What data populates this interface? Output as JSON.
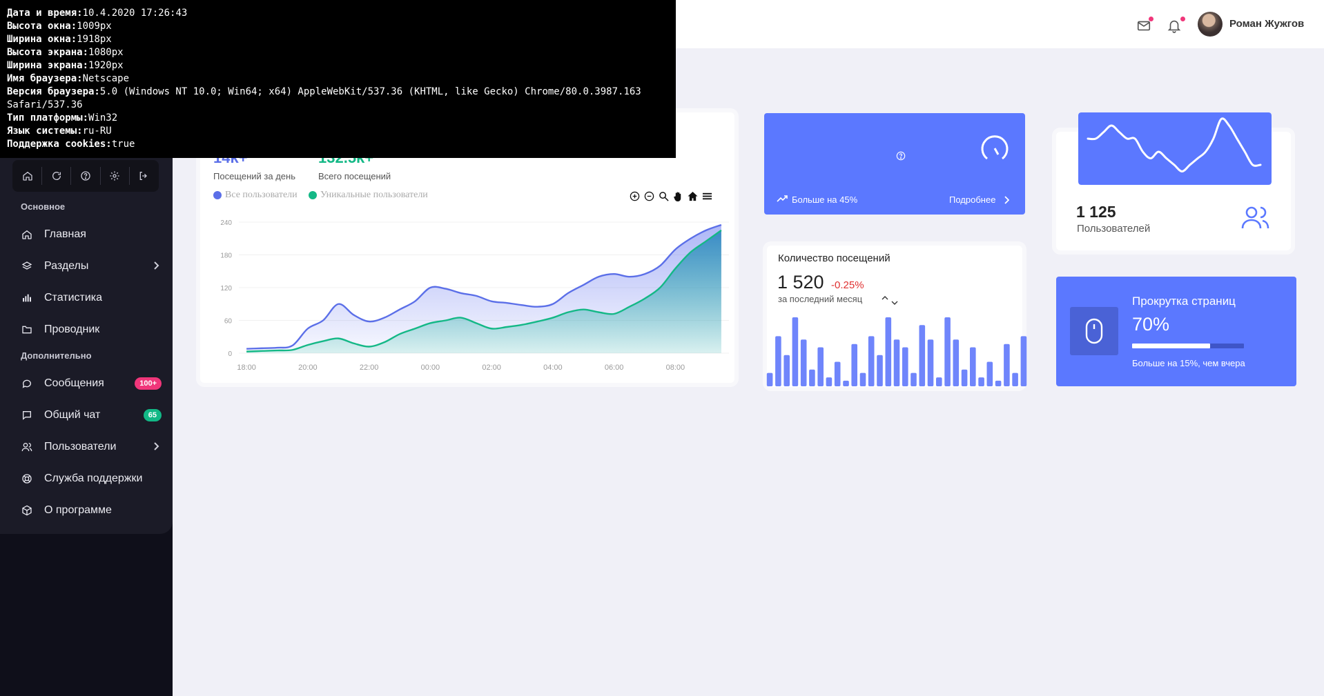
{
  "sysinfo": [
    {
      "label": "Дата и время:",
      "value": "10.4.2020 17:26:43"
    },
    {
      "label": "Высота окна:",
      "value": "1009px"
    },
    {
      "label": "Ширина окна:",
      "value": "1918px"
    },
    {
      "label": "Высота экрана:",
      "value": "1080px"
    },
    {
      "label": "Ширина экрана:",
      "value": "1920px"
    },
    {
      "label": "Имя браузера:",
      "value": "Netscape"
    },
    {
      "label": "Версия браузера:",
      "value": "5.0 (Windows NT 10.0; Win64; x64) AppleWebKit/537.36 (KHTML, like Gecko) Chrome/80.0.3987.163"
    },
    {
      "label": "",
      "value": "Safari/537.36"
    },
    {
      "label": "Тип платформы:",
      "value": "Win32"
    },
    {
      "label": "Язык системы:",
      "value": "ru-RU"
    },
    {
      "label": "Поддержка cookies:",
      "value": "true"
    }
  ],
  "header": {
    "user_name": "Роман Жужгов",
    "mail_icon": "mail-icon",
    "bell_icon": "bell-icon"
  },
  "sidebar": {
    "toolbar_icons": [
      "home-icon",
      "refresh-icon",
      "help-icon",
      "settings-icon",
      "logout-icon"
    ],
    "section_main": "Основное",
    "section_extra": "Дополнительно",
    "items": [
      {
        "label": "Главная",
        "icon": "home-icon"
      },
      {
        "label": "Разделы",
        "icon": "layers-icon",
        "chevron": true
      },
      {
        "label": "Статистика",
        "icon": "bar-chart-icon"
      },
      {
        "label": "Проводник",
        "icon": "folder-icon"
      },
      {
        "label": "Сообщения",
        "icon": "chat-bubble-icon",
        "badge": "100+",
        "badge_color": "#f0367a"
      },
      {
        "label": "Общий чат",
        "icon": "message-square-icon",
        "badge": "65",
        "badge_color": "#12b886"
      },
      {
        "label": "Пользователи",
        "icon": "users-icon",
        "chevron": true
      },
      {
        "label": "Служба поддержки",
        "icon": "lifebuoy-icon"
      },
      {
        "label": "О программе",
        "icon": "box-icon"
      }
    ]
  },
  "visits_card": {
    "daily_value": "14k+",
    "daily_label": "Посещений за день",
    "total_value": "132.5k+",
    "total_label": "Всего посещений",
    "legend": [
      {
        "name": "Все пользователи",
        "color": "#5b6fe8"
      },
      {
        "name": "Уникальные пользователи",
        "color": "#14b886"
      }
    ],
    "tools": [
      "zoom-in-icon",
      "zoom-out-icon",
      "magnify-icon",
      "pan-hand-icon",
      "home-reset-icon",
      "menu-icon"
    ]
  },
  "chart_data": [
    {
      "type": "area",
      "x_ticks": [
        "18:00",
        "20:00",
        "22:00",
        "00:00",
        "02:00",
        "04:00",
        "06:00",
        "08:00"
      ],
      "y_ticks": [
        0,
        60,
        120,
        180,
        240
      ],
      "ylim": [
        0,
        240
      ],
      "legend_position": "top-left",
      "series": [
        {
          "name": "Все пользователи",
          "color": "#5b6fe8",
          "x": [
            "17:00",
            "17:30",
            "18:00",
            "18:30",
            "19:00",
            "19:30",
            "20:00",
            "20:30",
            "21:00",
            "21:30",
            "22:00",
            "22:30",
            "23:00",
            "23:30",
            "00:00",
            "00:30",
            "01:00",
            "01:30",
            "02:00",
            "02:30",
            "03:00",
            "03:30",
            "04:00",
            "04:30",
            "05:00",
            "05:30",
            "06:00",
            "06:30",
            "07:00",
            "07:30",
            "08:00",
            "08:30",
            "09:00",
            "09:30"
          ],
          "values": [
            13,
            10,
            8,
            9,
            10,
            14,
            45,
            60,
            90,
            70,
            58,
            65,
            80,
            95,
            120,
            118,
            110,
            105,
            95,
            92,
            88,
            85,
            90,
            110,
            125,
            140,
            145,
            140,
            145,
            160,
            190,
            210,
            225,
            235
          ]
        },
        {
          "name": "Уникальные пользователи",
          "color": "#14b886",
          "x": [
            "17:00",
            "17:30",
            "18:00",
            "18:30",
            "19:00",
            "19:30",
            "20:00",
            "20:30",
            "21:00",
            "21:30",
            "22:00",
            "22:30",
            "23:00",
            "23:30",
            "00:00",
            "00:30",
            "01:00",
            "01:30",
            "02:00",
            "02:30",
            "03:00",
            "03:30",
            "04:00",
            "04:30",
            "05:00",
            "05:30",
            "06:00",
            "06:30",
            "07:00",
            "07:30",
            "08:00",
            "08:30",
            "09:00",
            "09:30"
          ],
          "values": [
            5,
            4,
            3,
            4,
            5,
            6,
            15,
            22,
            27,
            18,
            12,
            20,
            35,
            45,
            55,
            60,
            65,
            55,
            45,
            48,
            52,
            58,
            65,
            75,
            80,
            75,
            72,
            85,
            100,
            120,
            155,
            185,
            205,
            225
          ]
        }
      ]
    },
    {
      "type": "area",
      "series": [
        {
          "name": "",
          "values": [
            6,
            6,
            7,
            8,
            7,
            6,
            6,
            4,
            3,
            4,
            3,
            2,
            1,
            2,
            3,
            4,
            6,
            9,
            8,
            6,
            4,
            2,
            2
          ]
        }
      ]
    },
    {
      "type": "bar",
      "series": [
        {
          "name": "",
          "values": [
            12,
            45,
            28,
            62,
            42,
            15,
            35,
            8,
            22,
            5,
            38,
            12,
            45,
            28,
            62,
            42,
            35,
            12,
            55,
            42,
            8,
            62,
            42,
            15,
            35,
            8,
            22,
            5,
            38,
            12,
            45
          ]
        }
      ]
    }
  ],
  "speed_card": {
    "icon": "speedometer-icon",
    "center_icon": "help-circle-icon",
    "trend_label": "Больше на 45%",
    "more_label": "Подробнее"
  },
  "visits_count_card": {
    "title": "Количество посещений",
    "value": "1 520",
    "change": "-0.25%",
    "subtitle": "за последний месяц"
  },
  "users_card": {
    "value": "1 125",
    "label": "Пользователей",
    "icon": "users-icon"
  },
  "scroll_card": {
    "title": "Прокрутка страниц",
    "value": "70%",
    "progress": 0.7,
    "note": "Больше на 15%, чем вчера",
    "icon": "mouse-icon"
  }
}
